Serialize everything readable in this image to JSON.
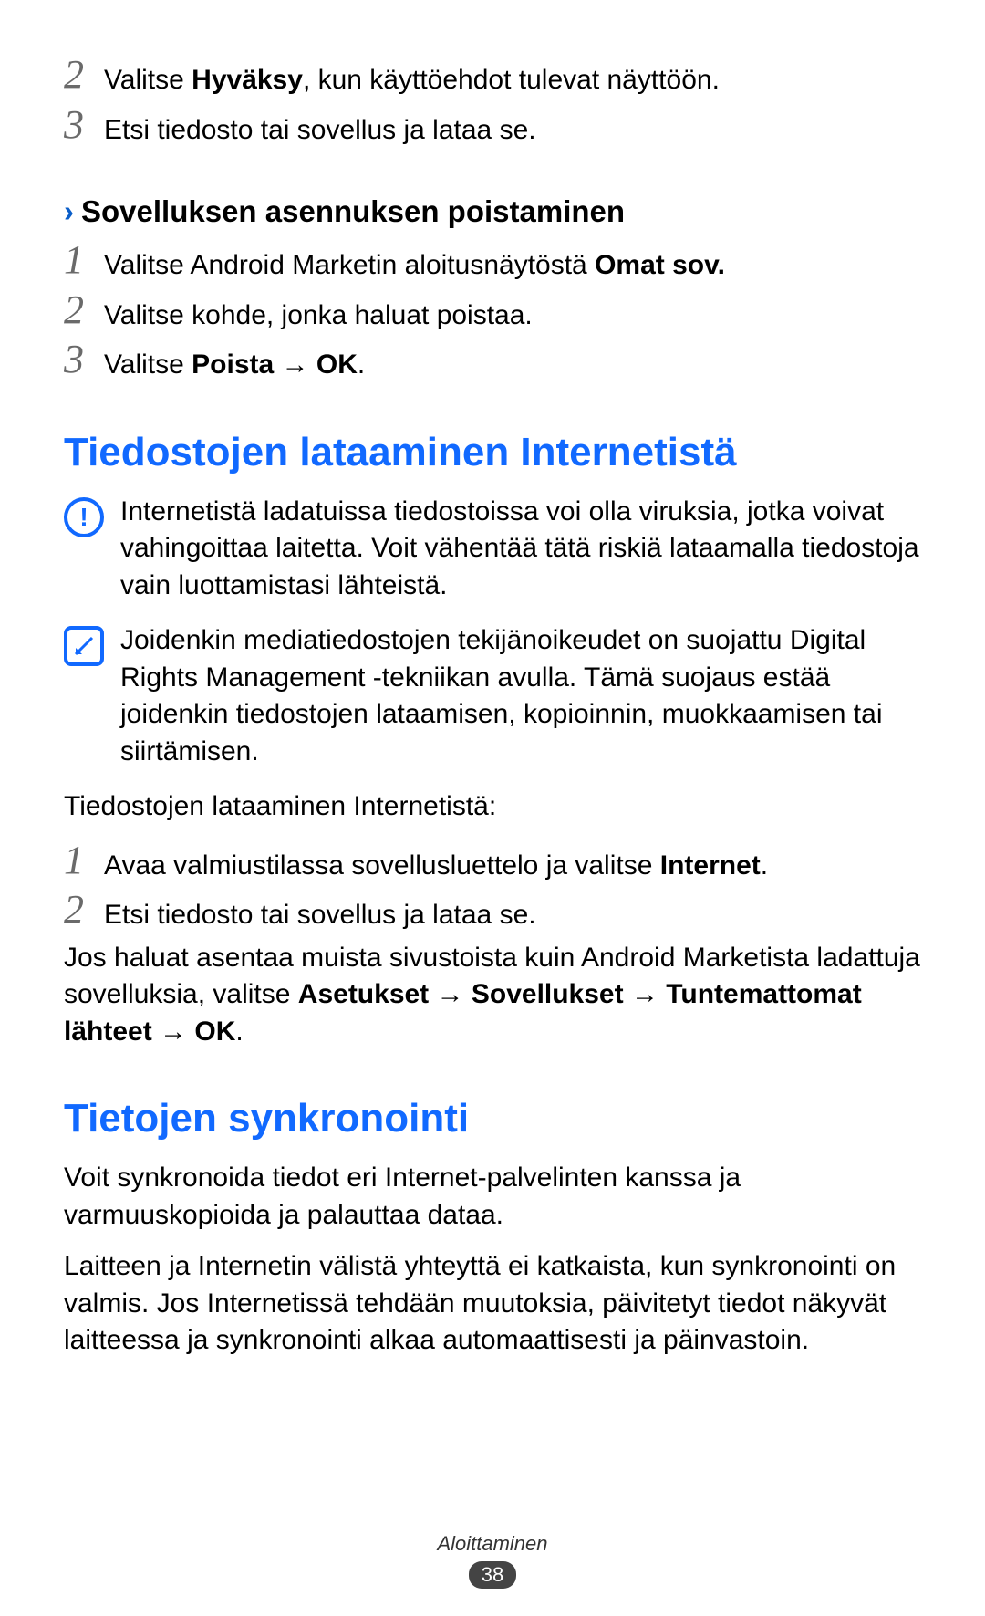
{
  "top_steps": [
    {
      "num": "2",
      "pre": "Valitse ",
      "bold": "Hyväksy",
      "post": ", kun käyttöehdot tulevat näyttöön."
    },
    {
      "num": "3",
      "pre": "Etsi tiedosto tai sovellus ja lataa se.",
      "bold": "",
      "post": ""
    }
  ],
  "subhead1": "Sovelluksen asennuksen poistaminen",
  "uninstall_steps": {
    "s1": {
      "num": "1",
      "pre": "Valitse Android Marketin aloitusnäytöstä ",
      "bold": "Omat sov."
    },
    "s2": {
      "num": "2",
      "text": "Valitse kohde, jonka haluat poistaa."
    },
    "s3": {
      "num": "3",
      "pre": "Valitse ",
      "b1": "Poista",
      "arrow": " → ",
      "b2": "OK",
      "post": "."
    }
  },
  "h2_downloads": "Tiedostojen lataaminen Internetistä",
  "warn_text": "Internetistä ladatuissa tiedostoissa voi olla viruksia, jotka voivat vahingoittaa laitetta. Voit vähentää tätä riskiä lataamalla tiedostoja vain luottamistasi lähteistä.",
  "note_text": "Joidenkin mediatiedostojen tekijänoikeudet on suojattu Digital Rights Management -tekniikan avulla. Tämä suojaus estää joidenkin tiedostojen lataamisen, kopioinnin, muokkaamisen tai siirtämisen.",
  "download_intro": "Tiedostojen lataaminen Internetistä:",
  "download_steps": {
    "s1": {
      "num": "1",
      "pre": "Avaa valmiustilassa sovellusluettelo ja valitse ",
      "bold": "Internet",
      "post": "."
    },
    "s2": {
      "num": "2",
      "text": "Etsi tiedosto tai sovellus ja lataa se."
    }
  },
  "install_para": {
    "pre": "Jos haluat asentaa muista sivustoista kuin Android Marketista ladattuja sovelluksia, valitse ",
    "b1": "Asetukset",
    "a1": " → ",
    "b2": "Sovellukset",
    "a2": " → ",
    "b3": "Tuntemattomat lähteet",
    "a3": " → ",
    "b4": "OK",
    "post": "."
  },
  "h2_sync": "Tietojen synkronointi",
  "sync_p1": "Voit synkronoida tiedot eri Internet-palvelinten kanssa ja varmuuskopioida ja palauttaa dataa.",
  "sync_p2": "Laitteen ja Internetin välistä yhteyttä ei katkaista, kun synkronointi on valmis. Jos Internetissä tehdään muutoksia, päivitetyt tiedot näkyvät laitteessa ja synkronointi alkaa automaattisesti ja päinvastoin.",
  "footer_label": "Aloittaminen",
  "page_number": "38"
}
